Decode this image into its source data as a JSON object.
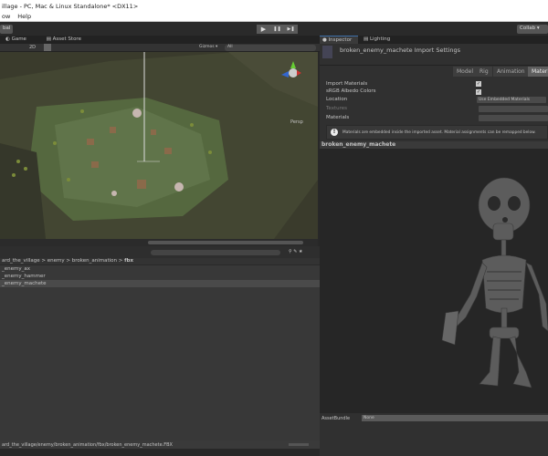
{
  "window": {
    "title": "illage - PC, Mac & Linux Standalone* <DX11>",
    "menu": [
      "ow",
      "Help"
    ]
  },
  "toolbar": {
    "left_button": "bal",
    "play": "▶",
    "pause": "❚❚",
    "step": "▶❚",
    "collab": "Collab ▾"
  },
  "scene_tabs": [
    "Game",
    "Asset Store"
  ],
  "scene_bar": {
    "mode": "2D",
    "gizmos": "Gizmos ▾",
    "search": "All"
  },
  "scene": {
    "view_label": "Persp"
  },
  "project": {
    "breadcrumb": [
      "ard_the_village",
      "enemy",
      "broken_animation",
      "fbx"
    ],
    "items": [
      {
        "name": "_enemy_ax",
        "selected": false
      },
      {
        "name": "_enemy_hammer",
        "selected": false
      },
      {
        "name": "_enemy_machete",
        "selected": true
      }
    ],
    "path": "ard_the_village/enemy/broken_animation/fbx/broken_enemy_machete.FBX"
  },
  "inspector": {
    "tabs": [
      "Inspector",
      "Lighting"
    ],
    "title": "broken_enemy_machete Import Settings",
    "subtabs": [
      "Model",
      "Rig",
      "Animation",
      "Materials"
    ],
    "active_subtab": "Materials",
    "rows": {
      "import_materials": "Import Materials",
      "srgb": "sRGB Albedo Colors",
      "location": "Location",
      "location_value": "Use Embedded Materials",
      "textures": "Textures",
      "materials": "Materials"
    },
    "info": "Materials are embedded inside the imported asset. Material assignments can be remapped below.",
    "preview_title": "broken_enemy_machete",
    "assetbundle_label": "AssetBundle",
    "assetbundle_value": "None"
  },
  "colors": {
    "accent": "#3d6ea8",
    "terrain": "#4b5a36"
  }
}
